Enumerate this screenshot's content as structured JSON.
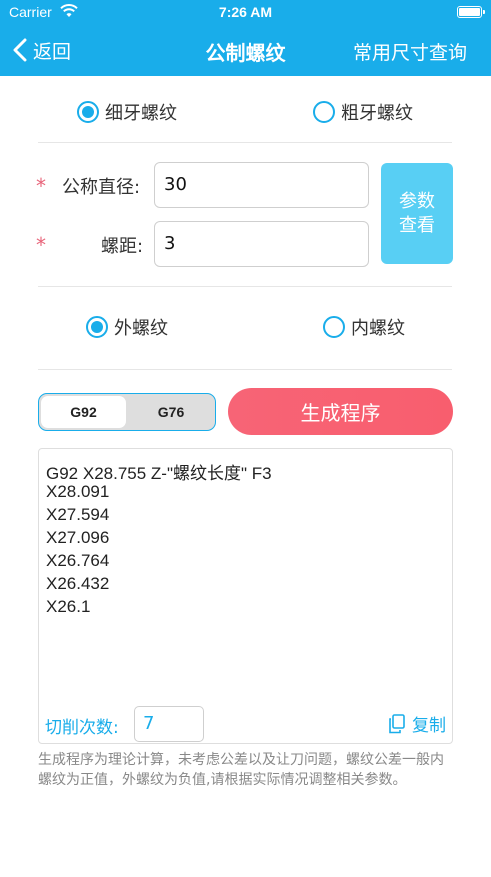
{
  "status_bar": {
    "carrier": "Carrier",
    "time": "7:26 AM"
  },
  "nav": {
    "back_label": "返回",
    "title": "公制螺纹",
    "right_label": "常用尺寸查询"
  },
  "thread_type": {
    "fine_label": "细牙螺纹",
    "coarse_label": "粗牙螺纹",
    "selected": "fine"
  },
  "fields": {
    "diameter": {
      "label": "公称直径:",
      "value": "30",
      "required_mark": "*"
    },
    "pitch": {
      "label": "螺距:",
      "value": "3",
      "required_mark": "*"
    }
  },
  "param_button": {
    "line1": "参数",
    "line2": "查看"
  },
  "thread_side": {
    "external_label": "外螺纹",
    "internal_label": "内螺纹",
    "selected": "external"
  },
  "mode": {
    "options": [
      "G92",
      "G76"
    ],
    "selected": "G92"
  },
  "generate_label": "生成程序",
  "output_lines": [
    "G92 X28.755 Z-\"螺纹长度\" F3",
    "X28.091",
    "X27.594",
    "X27.096",
    "X26.764",
    "X26.432",
    "X26.1"
  ],
  "cut_count": {
    "label": "切削次数:",
    "value": "7"
  },
  "copy_label": "复制",
  "note": "生成程序为理论计算，未考虑公差以及让刀问题，螺纹公差一般内螺纹为正值，外螺纹为负值,请根据实际情况调整相关参数。",
  "colors": {
    "primary": "#19ADEA",
    "param_button": "#58CFF4",
    "generate": "#F76476",
    "required": "#E8647A"
  }
}
